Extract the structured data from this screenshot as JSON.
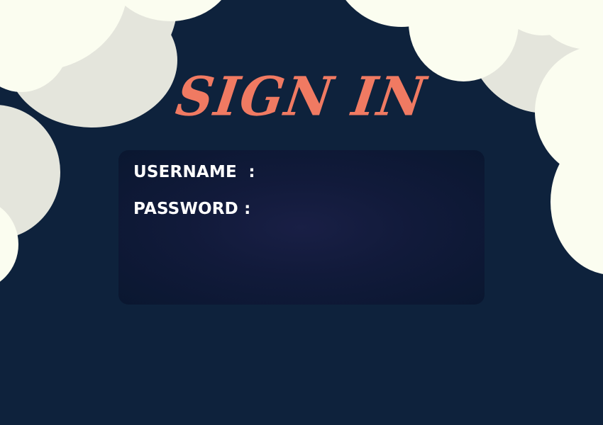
{
  "page": {
    "title": "SIGN IN"
  },
  "form": {
    "username_label": "USERNAME  :",
    "username_value": "",
    "password_label": "PASSWORD :",
    "password_value": ""
  },
  "colors": {
    "background": "#0e223c",
    "title": "#f07a62",
    "card": "#111a3a",
    "cloud_light": "#fbfdf0",
    "cloud_shade": "#e4e5dc",
    "label": "#ffffff"
  }
}
